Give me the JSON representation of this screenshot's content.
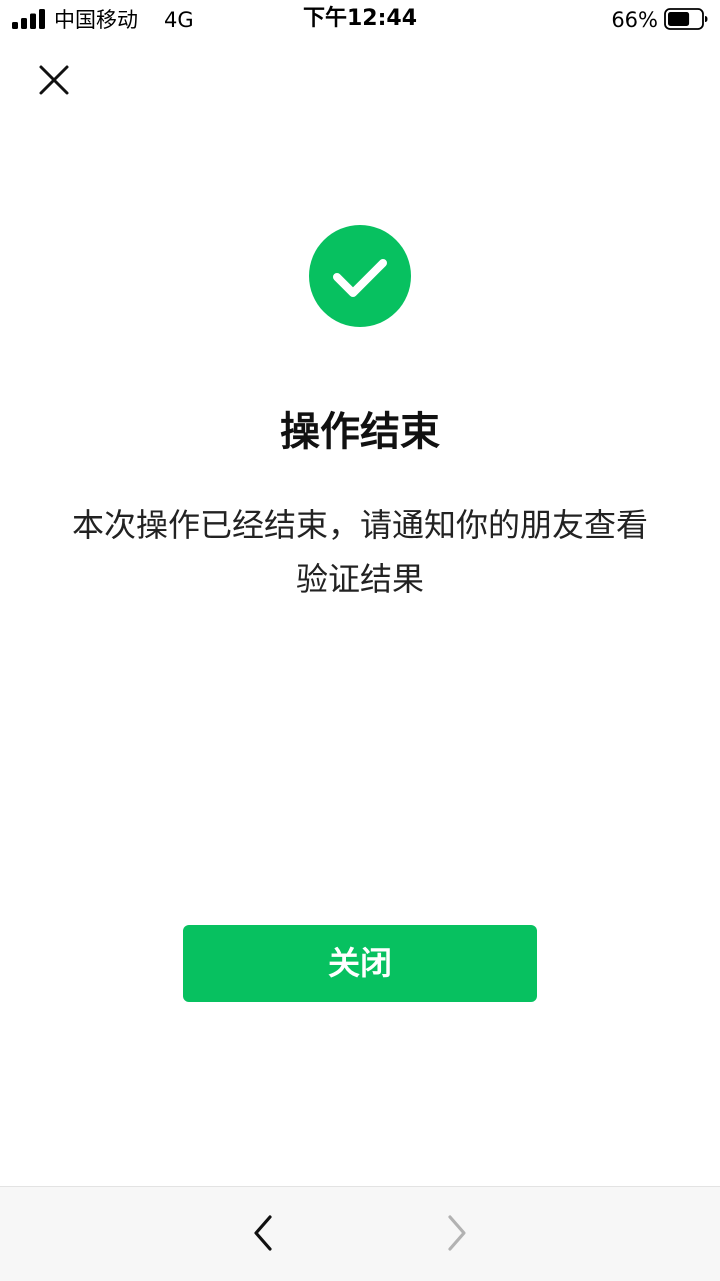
{
  "status_bar": {
    "carrier": "中国移动",
    "network": "4G",
    "time": "下午12:44",
    "battery_percent": "66%",
    "battery_level": 0.66
  },
  "header": {
    "close_icon": "close-icon"
  },
  "result": {
    "icon": "check-circle-icon",
    "title": "操作结束",
    "message": "本次操作已经结束，请通知你的朋友查看验证结果"
  },
  "actions": {
    "close_label": "关闭"
  },
  "toolbar": {
    "back_icon": "chevron-left-icon",
    "forward_icon": "chevron-right-icon",
    "forward_enabled": false
  },
  "colors": {
    "brand_green": "#07c160",
    "disabled_gray": "#b2b2b2"
  }
}
